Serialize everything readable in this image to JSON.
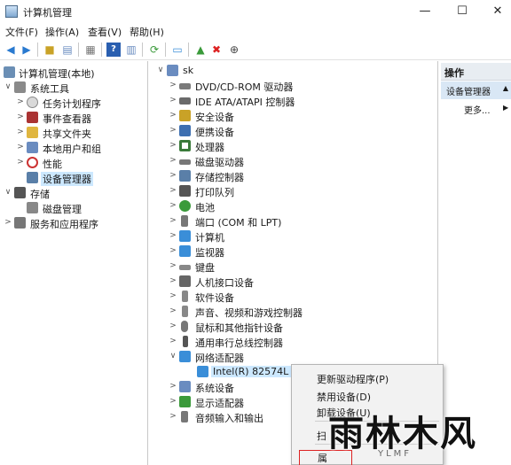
{
  "window": {
    "title": "计算机管理",
    "min": "—",
    "max": "☐",
    "close": "✕"
  },
  "menu": [
    "文件(F)",
    "操作(A)",
    "查看(V)",
    "帮助(H)"
  ],
  "left_tree": [
    {
      "label": "计算机管理(本地)",
      "arrow": "",
      "icon": "computer-management-icon",
      "color": "#6b8fb5"
    },
    {
      "label": "系统工具",
      "arrow": "∨",
      "icon": "tools-icon",
      "color": "#8a8a8a"
    },
    {
      "label": "任务计划程序",
      "arrow": ">",
      "icon": "clock-icon",
      "color": "#d9d9d9"
    },
    {
      "label": "事件查看器",
      "arrow": ">",
      "icon": "event-viewer-icon",
      "color": "#a33"
    },
    {
      "label": "共享文件夹",
      "arrow": ">",
      "icon": "shared-folder-icon",
      "color": "#e0b640"
    },
    {
      "label": "本地用户和组",
      "arrow": ">",
      "icon": "users-icon",
      "color": "#6a8cc0"
    },
    {
      "label": "性能",
      "arrow": ">",
      "icon": "performance-icon",
      "color": "#c33"
    },
    {
      "label": "设备管理器",
      "arrow": "",
      "icon": "device-manager-icon",
      "color": "#5a7fa8"
    },
    {
      "label": "存储",
      "arrow": "∨",
      "icon": "storage-icon",
      "color": "#555"
    },
    {
      "label": "磁盘管理",
      "arrow": "",
      "icon": "disk-management-icon",
      "color": "#888"
    },
    {
      "label": "服务和应用程序",
      "arrow": ">",
      "icon": "services-icon",
      "color": "#777"
    }
  ],
  "device_tree": [
    {
      "label": "sk",
      "arrow": "∨",
      "icon": "computer-icon",
      "color": "#6a8cc0"
    },
    {
      "label": "DVD/CD-ROM 驱动器",
      "arrow": ">",
      "icon": "dvd-drive-icon",
      "color": "#7a7a7a"
    },
    {
      "label": "IDE ATA/ATAPI 控制器",
      "arrow": ">",
      "icon": "ide-controller-icon",
      "color": "#6a6a6a"
    },
    {
      "label": "安全设备",
      "arrow": ">",
      "icon": "security-device-icon",
      "color": "#c9a227"
    },
    {
      "label": "便携设备",
      "arrow": ">",
      "icon": "portable-device-icon",
      "color": "#3d6fb0"
    },
    {
      "label": "处理器",
      "arrow": ">",
      "icon": "processor-icon",
      "color": "#3a7a3a"
    },
    {
      "label": "磁盘驱动器",
      "arrow": ">",
      "icon": "disk-drive-icon",
      "color": "#777"
    },
    {
      "label": "存储控制器",
      "arrow": ">",
      "icon": "storage-controller-icon",
      "color": "#5a7fa8"
    },
    {
      "label": "打印队列",
      "arrow": ">",
      "icon": "printer-icon",
      "color": "#555"
    },
    {
      "label": "电池",
      "arrow": ">",
      "icon": "battery-icon",
      "color": "#3a9a3a"
    },
    {
      "label": "端口 (COM 和 LPT)",
      "arrow": ">",
      "icon": "port-icon",
      "color": "#777"
    },
    {
      "label": "计算机",
      "arrow": ">",
      "icon": "monitor-icon",
      "color": "#3a8ed8"
    },
    {
      "label": "监视器",
      "arrow": ">",
      "icon": "display-monitor-icon",
      "color": "#3a8ed8"
    },
    {
      "label": "键盘",
      "arrow": ">",
      "icon": "keyboard-icon",
      "color": "#888"
    },
    {
      "label": "人机接口设备",
      "arrow": ">",
      "icon": "hid-icon",
      "color": "#666"
    },
    {
      "label": "软件设备",
      "arrow": ">",
      "icon": "software-device-icon",
      "color": "#888"
    },
    {
      "label": "声音、视频和游戏控制器",
      "arrow": ">",
      "icon": "sound-icon",
      "color": "#888"
    },
    {
      "label": "鼠标和其他指针设备",
      "arrow": ">",
      "icon": "mouse-icon",
      "color": "#777"
    },
    {
      "label": "通用串行总线控制器",
      "arrow": ">",
      "icon": "usb-icon",
      "color": "#555"
    },
    {
      "label": "网络适配器",
      "arrow": "∨",
      "icon": "network-adapter-icon",
      "color": "#3a8ed8"
    },
    {
      "label": "Intel(R) 82574L G",
      "arrow": "",
      "icon": "network-card-icon",
      "color": "#3a8ed8"
    },
    {
      "label": "系统设备",
      "arrow": ">",
      "icon": "system-device-icon",
      "color": "#6a8cc0"
    },
    {
      "label": "显示适配器",
      "arrow": ">",
      "icon": "display-adapter-icon",
      "color": "#3a9a3a"
    },
    {
      "label": "音频输入和输出",
      "arrow": ">",
      "icon": "audio-icon",
      "color": "#777"
    }
  ],
  "actions": {
    "header": "操作",
    "section": "设备管理器",
    "more": "更多..."
  },
  "context_menu": [
    "更新驱动程序(P)",
    "禁用设备(D)",
    "卸载设备(U)",
    "扫",
    "属"
  ],
  "watermark": {
    "cn": "雨林木风",
    "en": "YLMF"
  }
}
